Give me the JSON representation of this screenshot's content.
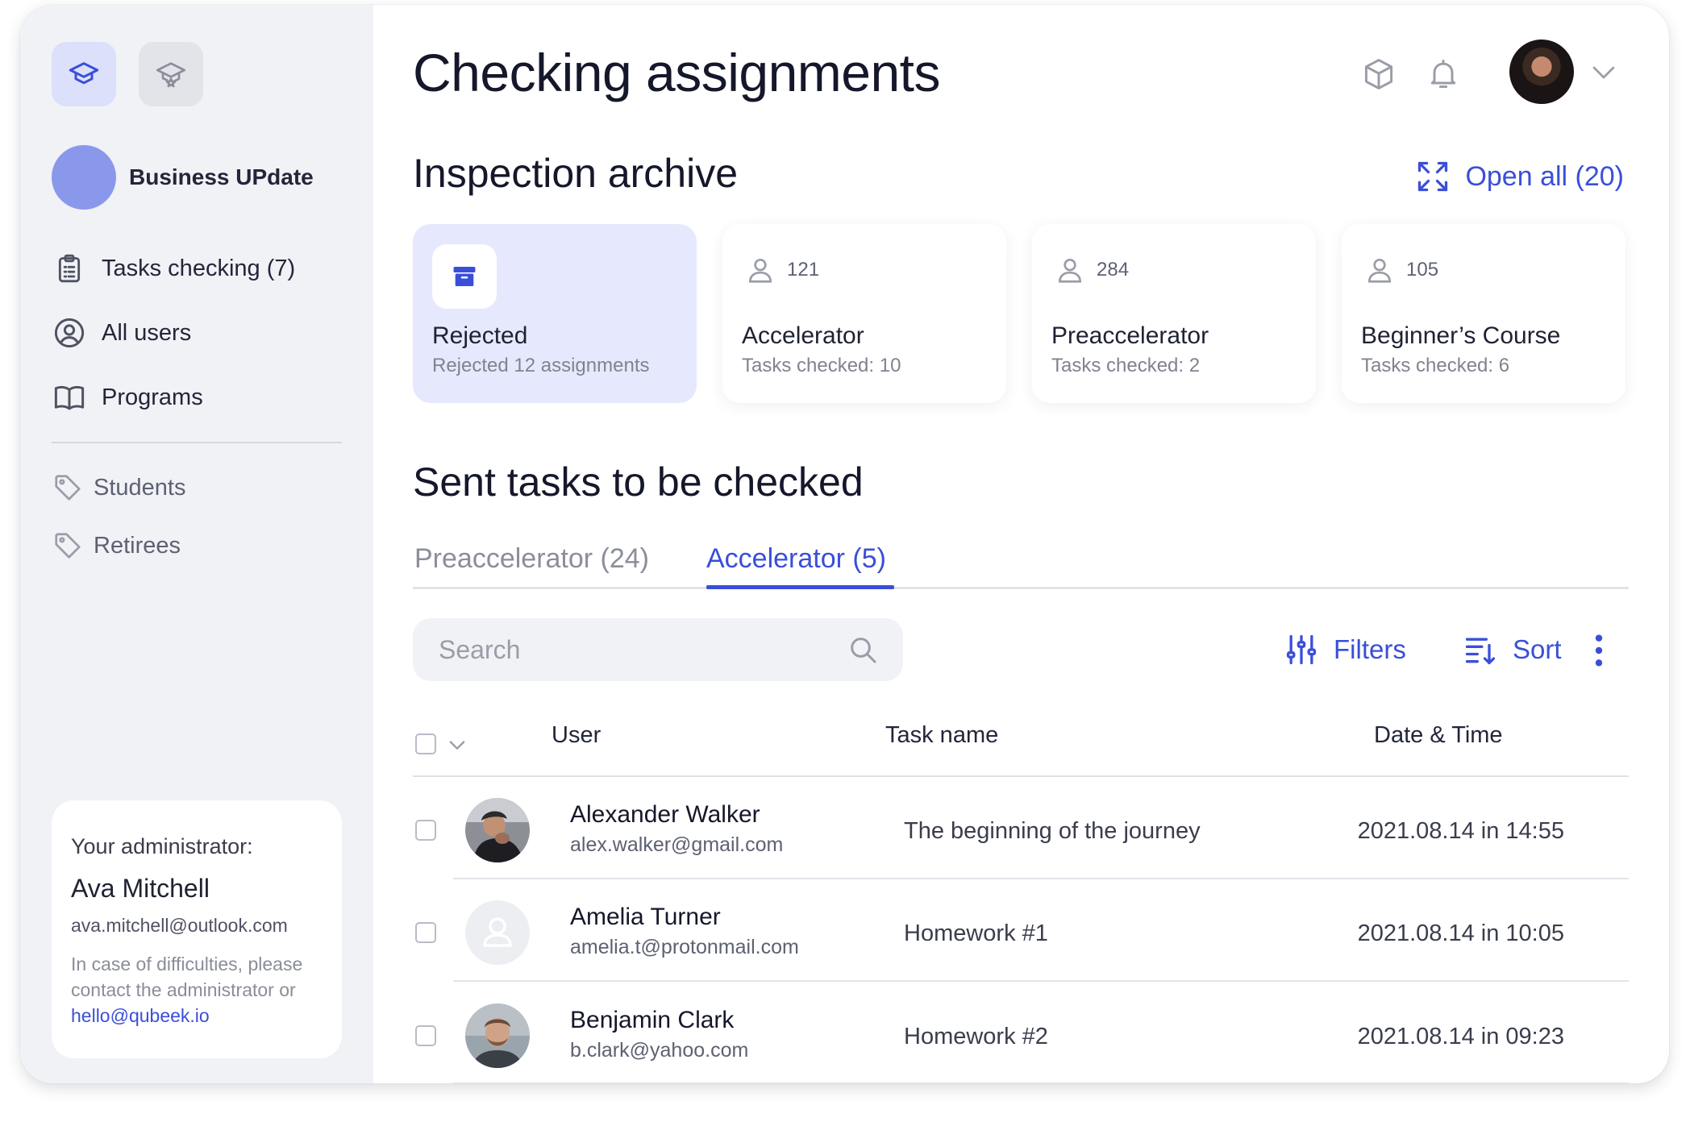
{
  "sidebar": {
    "org_name": "Business UPdate",
    "nav": [
      {
        "label": "Tasks checking (7)",
        "icon": "clipboard-icon"
      },
      {
        "label": "All users",
        "icon": "user-circle-icon"
      },
      {
        "label": "Programs",
        "icon": "book-icon"
      }
    ],
    "tags": [
      {
        "label": "Students",
        "icon": "tag-icon"
      },
      {
        "label": "Retirees",
        "icon": "tag-icon"
      }
    ],
    "admin": {
      "caption": "Your administrator:",
      "name": "Ava Mitchell",
      "email": "ava.mitchell@outlook.com",
      "note": "In case of difficulties, please contact the administrator or",
      "link": "hello@qubeek.io"
    }
  },
  "header": {
    "title": "Checking assignments"
  },
  "archive": {
    "title": "Inspection archive",
    "open_all": "Open all (20)",
    "cards": [
      {
        "title": "Rejected",
        "subtitle": "Rejected 12 assignments",
        "icon": "archive-box-icon",
        "active": true
      },
      {
        "count": "121",
        "title": "Accelerator",
        "subtitle": "Tasks checked: 10",
        "icon": "user-icon"
      },
      {
        "count": "284",
        "title": "Preaccelerator",
        "subtitle": "Tasks checked: 2",
        "icon": "user-icon"
      },
      {
        "count": "105",
        "title": "Beginner’s Course",
        "subtitle": "Tasks checked: 6",
        "icon": "user-icon"
      }
    ]
  },
  "sent": {
    "title": "Sent tasks to be checked",
    "tabs": [
      {
        "label": "Preaccelerator (24)",
        "active": false
      },
      {
        "label": "Accelerator (5)",
        "active": true
      }
    ],
    "search_placeholder": "Search",
    "filters_label": "Filters",
    "sort_label": "Sort",
    "columns": [
      "User",
      "Task name",
      "Date & Time"
    ],
    "rows": [
      {
        "name": "Alexander Walker",
        "email": "alex.walker@gmail.com",
        "task": "The beginning of the journey",
        "datetime": "2021.08.14 in 14:55",
        "avatar": "photo"
      },
      {
        "name": "Amelia Turner",
        "email": "amelia.t@protonmail.com",
        "task": "Homework #1",
        "datetime": "2021.08.14 in 10:05",
        "avatar": "placeholder"
      },
      {
        "name": "Benjamin Clark",
        "email": "b.clark@yahoo.com",
        "task": "Homework #2",
        "datetime": "2021.08.14 in 09:23",
        "avatar": "photo"
      }
    ]
  },
  "colors": {
    "accent": "#3a4fd8",
    "sidebar_bg": "#f1f2f6",
    "active_card_bg": "#e6e9fd",
    "org_avatar": "#8a98ec"
  }
}
